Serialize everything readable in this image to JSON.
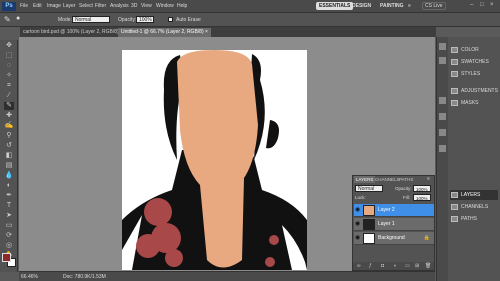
{
  "app": {
    "logo": "Ps",
    "zoom": "100%"
  },
  "menu": [
    "File",
    "Edit",
    "Image",
    "Layer",
    "Select",
    "Filter",
    "Analysis",
    "3D",
    "View",
    "Window",
    "Help"
  ],
  "workspace_buttons": {
    "essentials": "ESSENTIALS",
    "design": "DESIGN",
    "painting": "PAINTING",
    "more": "»",
    "cs_live": "CS Live"
  },
  "options": {
    "mode_label": "Mode:",
    "mode_value": "Normal",
    "opacity_label": "Opacity:",
    "opacity_value": "100%",
    "autoerase_label": "Auto Erase"
  },
  "tabs": [
    {
      "label": "cartoon bird.psd @ 100% (Layer 2, RGB/8) ×",
      "active": false
    },
    {
      "label": "Untitled-1 @ 66.7% (Layer 2, RGB/8) ×",
      "active": true
    }
  ],
  "status": {
    "zoom": "66.46%",
    "doc": "Doc: 780.9K/1.53M"
  },
  "dock": {
    "group1": [
      {
        "label": "COLOR",
        "icon": "color-icon"
      },
      {
        "label": "SWATCHES",
        "icon": "swatches-icon"
      },
      {
        "label": "STYLES",
        "icon": "styles-icon"
      }
    ],
    "group2": [
      {
        "label": "ADJUSTMENTS",
        "icon": "adjustments-icon"
      },
      {
        "label": "MASKS",
        "icon": "masks-icon"
      }
    ],
    "group3": [
      {
        "label": "LAYERS",
        "icon": "layers-icon",
        "selected": true
      },
      {
        "label": "CHANNELS",
        "icon": "channels-icon"
      },
      {
        "label": "PATHS",
        "icon": "paths-icon"
      }
    ]
  },
  "layers_panel": {
    "tabs": [
      "LAYERS",
      "CHANNELS",
      "PATHS"
    ],
    "blend_mode": "Normal",
    "opacity_label": "Opacity:",
    "opacity_value": "100%",
    "lock_label": "Lock:",
    "fill_label": "Fill:",
    "fill_value": "100%",
    "layers": [
      {
        "name": "Layer 2",
        "selected": true,
        "thumb": "#e8a880"
      },
      {
        "name": "Layer 1",
        "selected": false,
        "thumb": "#222222"
      },
      {
        "name": "Background",
        "selected": false,
        "thumb": "#ffffff",
        "locked": true
      }
    ]
  },
  "colors": {
    "skin": "#e8a880",
    "hair": "#111111",
    "accent": "#a84848",
    "selected_layer": "#3f8fe8"
  }
}
